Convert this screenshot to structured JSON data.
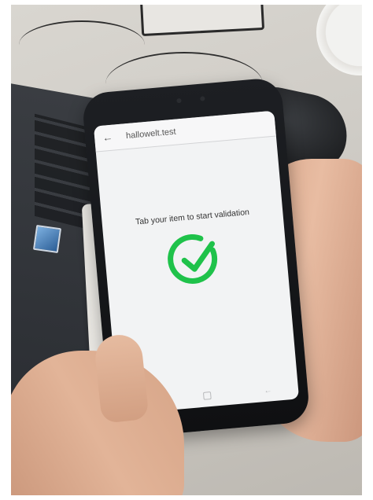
{
  "app": {
    "title": "hallowelt.test"
  },
  "screen": {
    "prompt": "Tab your item to start validation"
  },
  "icons": {
    "back": "arrow-left-icon",
    "status": "check-circle-icon",
    "nav_recent": "recent-apps-icon",
    "nav_home": "home-icon",
    "nav_back": "back-icon"
  },
  "colors": {
    "success": "#1fc24a"
  }
}
